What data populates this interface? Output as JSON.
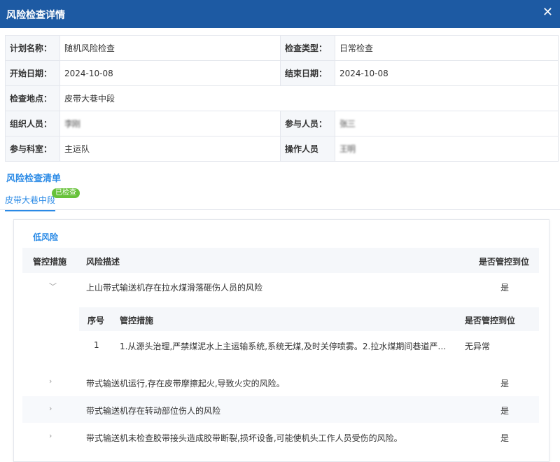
{
  "dialog": {
    "title": "风险检查详情",
    "close_icon": "close-icon"
  },
  "info": {
    "plan_name_label": "计划名称：",
    "plan_name": "随机风险检查",
    "check_type_label": "检查类型：",
    "check_type": "日常检查",
    "start_date_label": "开始日期：",
    "start_date": "2024-10-08",
    "end_date_label": "结束日期：",
    "end_date": "2024-10-08",
    "location_label": "检查地点：",
    "location": "皮带大巷中段",
    "organizer_label": "组织人员：",
    "organizer": "李刚",
    "participants_label": "参与人员：",
    "participants": "张三",
    "department_label": "参与科室：",
    "department": "主运队",
    "operator_label": "操作人员",
    "operator": "王明"
  },
  "risk_list": {
    "title": "风险检查清单",
    "tab_label": "皮带大巷中段",
    "tab_badge": "已检查",
    "level_label": "低风险",
    "headers": {
      "measures": "管控措施",
      "description": "风险描述",
      "controlled": "是否管控到位"
    },
    "rows": [
      {
        "description": "上山带式输送机存在拉水煤滑落砸伤人员的风险",
        "controlled": "是",
        "expanded": true
      },
      {
        "description": "带式输送机运行,存在皮带摩擦起火,导致火灾的风险。",
        "controlled": "是"
      },
      {
        "description": "带式输送机存在转动部位伤人的风险",
        "controlled": "是"
      },
      {
        "description": "带式输送机未检查胶带接头造成胶带断裂,损坏设备,可能使机头工作人员受伤的风险。",
        "controlled": "是"
      }
    ],
    "sub_table": {
      "headers": {
        "index": "序号",
        "measure": "管控措施",
        "controlled": "是否管控到位"
      },
      "rows": [
        {
          "index": "1",
          "measure": "1.从源头治理,严禁煤泥水上主运输系统,系统无煤,及时关停喷雾。2.拉水煤期间巷道严…",
          "controlled": "无异常"
        }
      ]
    }
  }
}
